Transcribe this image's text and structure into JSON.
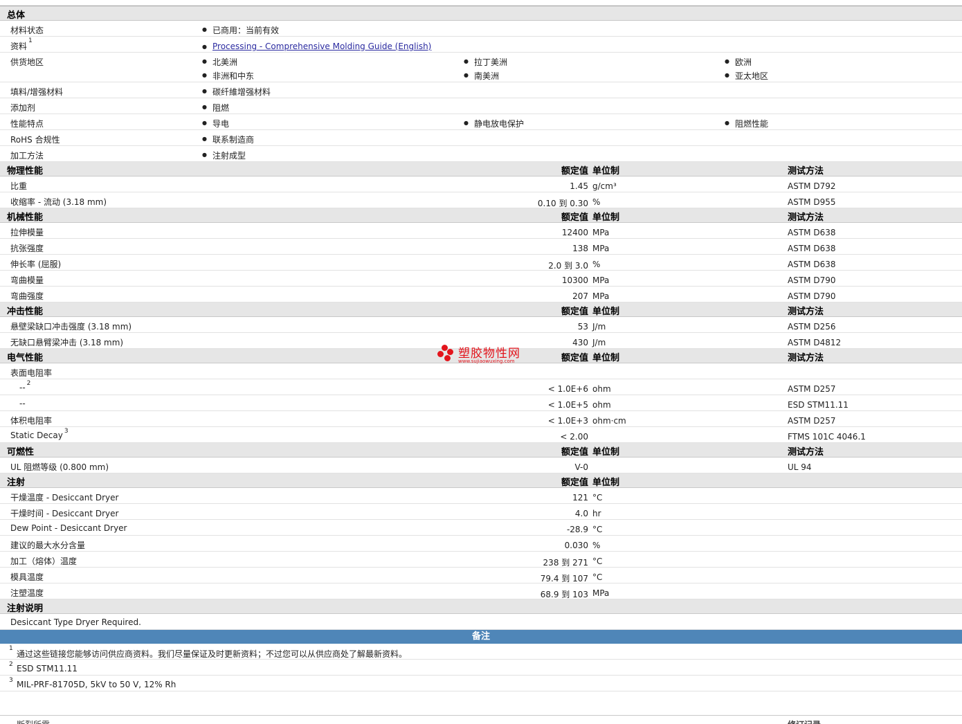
{
  "general": {
    "title": "总体",
    "material_status": {
      "label": "材料状态",
      "value": "已商用：当前有效"
    },
    "docs": {
      "label": "资料",
      "note": "1",
      "link": "Processing - Comprehensive Molding Guide (English)"
    },
    "regions": {
      "label": "供货地区",
      "items": [
        "北美洲",
        "拉丁美洲",
        "欧洲",
        "非洲和中东",
        "南美洲",
        "亚太地区"
      ]
    },
    "filler": {
      "label": "填料/增强材料",
      "value": "碳纤維增强材料"
    },
    "additive": {
      "label": "添加剂",
      "value": "阻燃"
    },
    "features": {
      "label": "性能特点",
      "items": [
        "导电",
        "静电放电保护",
        "阻燃性能"
      ]
    },
    "rohs": {
      "label": "RoHS 合规性",
      "value": "联系制造商"
    },
    "process": {
      "label": "加工方法",
      "value": "注射成型"
    }
  },
  "headers": {
    "value": "额定值",
    "unit": "单位制",
    "method": "测试方法"
  },
  "physical": {
    "title": "物理性能",
    "rows": [
      {
        "label": "比重",
        "value": "1.45",
        "unit": "g/cm³",
        "method": "ASTM D792"
      },
      {
        "label": "收缩率  - 流动  (3.18 mm)",
        "value": "0.10 到  0.30",
        "unit": "%",
        "method": "ASTM D955"
      }
    ]
  },
  "mechanical": {
    "title": "机械性能",
    "rows": [
      {
        "label": "拉伸模量",
        "value": "12400",
        "unit": "MPa",
        "method": "ASTM D638"
      },
      {
        "label": "抗张强度",
        "value": "138",
        "unit": "MPa",
        "method": "ASTM D638"
      },
      {
        "label": "伸长率  (屈服)",
        "value": "2.0 到  3.0",
        "unit": "%",
        "method": "ASTM D638"
      },
      {
        "label": "弯曲模量",
        "value": "10300",
        "unit": "MPa",
        "method": "ASTM D790"
      },
      {
        "label": "弯曲强度",
        "value": "207",
        "unit": "MPa",
        "method": "ASTM D790"
      }
    ]
  },
  "impact": {
    "title": "冲击性能",
    "rows": [
      {
        "label": "悬壁梁缺口冲击强度  (3.18 mm)",
        "value": "53",
        "unit": "J/m",
        "method": "ASTM D256"
      },
      {
        "label": "无缺口悬臂梁冲击  (3.18 mm)",
        "value": "430",
        "unit": "J/m",
        "method": "ASTM D4812"
      }
    ]
  },
  "electrical": {
    "title": "电气性能",
    "surface_label": "表面电阻率",
    "sub1": {
      "label": "--",
      "note": "2",
      "value": "< 1.0E+6",
      "unit": "ohm",
      "method": "ASTM D257"
    },
    "sub2": {
      "label": "--",
      "value": "< 1.0E+5",
      "unit": "ohm",
      "method": "ESD STM11.11"
    },
    "volume": {
      "label": "体积电阻率",
      "value": "< 1.0E+3",
      "unit": "ohm·cm",
      "method": "ASTM D257"
    },
    "decay": {
      "label": "Static Decay",
      "note": "3",
      "value": "< 2.00",
      "method": "FTMS 101C 4046.1"
    }
  },
  "flammability": {
    "title": "可燃性",
    "rows": [
      {
        "label": "UL 阻燃等级  (0.800 mm)",
        "value": "V-0",
        "method": "UL 94"
      }
    ]
  },
  "injection": {
    "title": "注射",
    "rows": [
      {
        "label": "干燥温度  - Desiccant Dryer",
        "value": "121",
        "unit": "°C"
      },
      {
        "label": "干燥时间  - Desiccant Dryer",
        "value": "4.0",
        "unit": "hr"
      },
      {
        "label": "Dew Point - Desiccant Dryer",
        "value": "-28.9",
        "unit": "°C"
      },
      {
        "label": "建议的最大水分含量",
        "value": "0.030",
        "unit": "%"
      },
      {
        "label": "加工（熔体）温度",
        "value": "238 到  271",
        "unit": "°C"
      },
      {
        "label": "模具温度",
        "value": "79.4 到  107",
        "unit": "°C"
      },
      {
        "label": "注塑温度",
        "value": "68.9 到  103",
        "unit": "MPa"
      }
    ]
  },
  "injection_notes": {
    "title": "注射说明",
    "text": "Desiccant Type Dryer Required."
  },
  "remarks": {
    "title": "备注",
    "notes": [
      {
        "n": "1",
        "text": "通过这些链接您能够访问供应商资料。我们尽量保证及时更新资料；不过您可以从供应商处了解最新资料。"
      },
      {
        "n": "2",
        "text": "ESD STM11.11"
      },
      {
        "n": "3",
        "text": "MIL-PRF-81705D, 5kV to 50 V, 12% Rh"
      }
    ]
  },
  "cutoff": {
    "left": "断裂所需",
    "right": "修订记录"
  },
  "watermark": {
    "name": "塑胶物性网",
    "url": "www.sujiaowuxing.com",
    "color": "#e3141c"
  }
}
